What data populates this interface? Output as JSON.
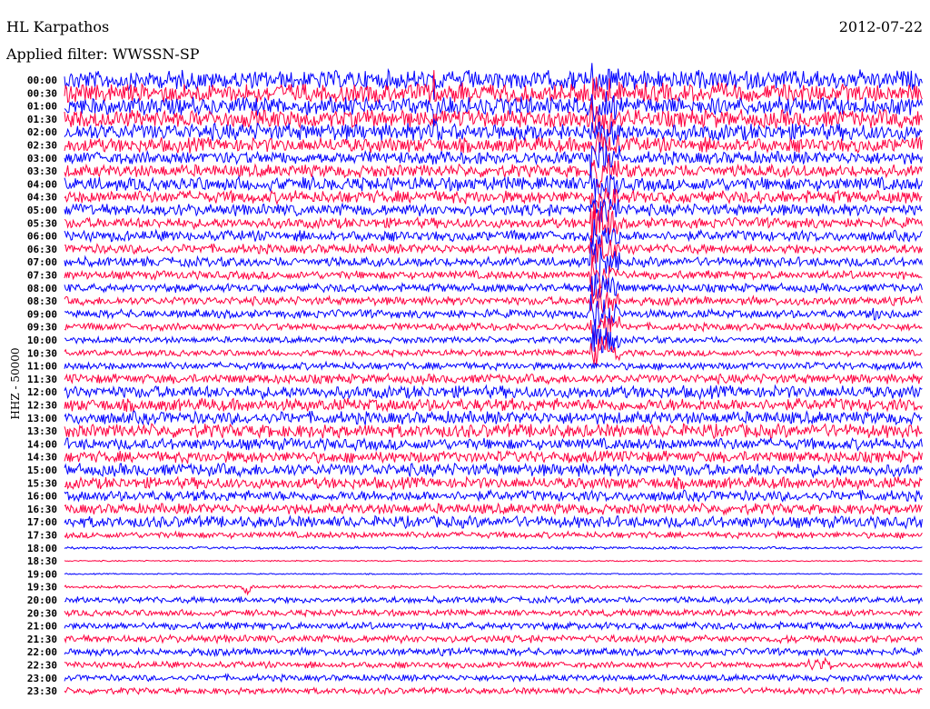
{
  "header": {
    "station": "HL Karpathos",
    "filter": "Applied filter: WWSSN-SP",
    "date": "2012-07-22",
    "channel": "HHZ - 50000"
  },
  "chart_data": {
    "type": "line",
    "title": "HL Karpathos",
    "subtitle": "Applied filter: WWSSN-SP",
    "ylabel": "HHZ - 50000",
    "minutes_per_row": 30,
    "row_labels": [
      "00:00",
      "00:30",
      "01:00",
      "01:30",
      "02:00",
      "02:30",
      "03:00",
      "03:30",
      "04:00",
      "04:30",
      "05:00",
      "05:30",
      "06:00",
      "06:30",
      "07:00",
      "07:30",
      "08:00",
      "08:30",
      "09:00",
      "09:30",
      "10:00",
      "10:30",
      "11:00",
      "11:30",
      "12:00",
      "12:30",
      "13:00",
      "13:30",
      "14:00",
      "14:30",
      "15:00",
      "15:30",
      "16:00",
      "16:30",
      "17:00",
      "17:30",
      "18:00",
      "18:30",
      "19:00",
      "19:30",
      "20:00",
      "20:30",
      "21:00",
      "21:30",
      "22:00",
      "22:30",
      "23:00",
      "23:30"
    ],
    "row_colors": [
      "#0000ff",
      "#ff0040"
    ],
    "relative_noise_amplitude": [
      0.9,
      0.9,
      0.85,
      0.85,
      0.8,
      0.7,
      0.6,
      0.6,
      0.65,
      0.6,
      0.55,
      0.5,
      0.5,
      0.45,
      0.45,
      0.4,
      0.4,
      0.4,
      0.4,
      0.35,
      0.3,
      0.3,
      0.35,
      0.45,
      0.6,
      0.6,
      0.6,
      0.65,
      0.55,
      0.55,
      0.6,
      0.55,
      0.5,
      0.5,
      0.55,
      0.3,
      0.12,
      0.06,
      0.06,
      0.15,
      0.3,
      0.3,
      0.35,
      0.35,
      0.35,
      0.3,
      0.3,
      0.3
    ],
    "events": [
      {
        "row_start": 0,
        "row_end": 21,
        "minute": 18.4,
        "duration_min": 1.0,
        "amplitude": 2.5
      },
      {
        "row_start": 0,
        "row_end": 4,
        "minute": 12.9,
        "duration_min": 0.1,
        "amplitude": 3.0
      },
      {
        "row_start": 39,
        "row_end": 39,
        "minute": 6.2,
        "duration_min": 0.4,
        "amplitude": 1.2
      },
      {
        "row_start": 45,
        "row_end": 45,
        "minute": 26.0,
        "duration_min": 0.8,
        "amplitude": 1.2
      },
      {
        "row_start": 18,
        "row_end": 18,
        "minute": 28.2,
        "duration_min": 0.8,
        "amplitude": 1.0
      },
      {
        "row_start": 10,
        "row_end": 10,
        "minute": 0.4,
        "duration_min": 0.6,
        "amplitude": 1.2
      }
    ]
  }
}
